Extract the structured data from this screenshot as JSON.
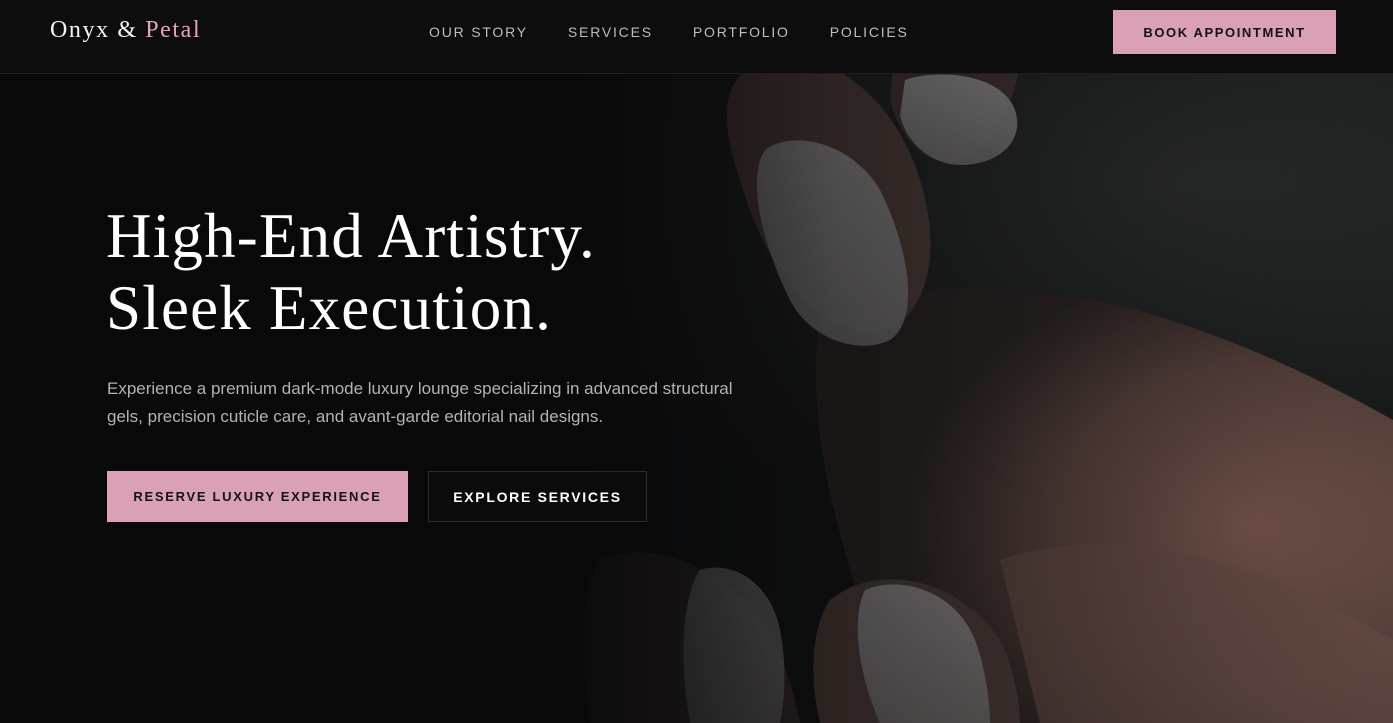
{
  "brand": {
    "name_part1": "Onyx &",
    "name_part2": "Petal"
  },
  "nav": {
    "items": [
      {
        "label": "OUR STORY"
      },
      {
        "label": "SERVICES"
      },
      {
        "label": "PORTFOLIO"
      },
      {
        "label": "POLICIES"
      }
    ]
  },
  "header": {
    "book_label": "BOOK APPOINTMENT"
  },
  "hero": {
    "title_line1": "High-End Artistry.",
    "title_line2": "Sleek Execution.",
    "description": "Experience a premium dark-mode luxury lounge specializing in advanced structural gels, precision cuticle care, and avant-garde editorial nail designs.",
    "primary_cta": "RESERVE LUXURY EXPERIENCE",
    "secondary_cta": "EXPLORE SERVICES",
    "image_subject": "manicured hands with white nails"
  },
  "colors": {
    "background": "#0b0b0c",
    "accent_pink": "#d9a0b7",
    "brand_accent": "#e3a3bb",
    "text_muted": "#b3b3b3"
  }
}
